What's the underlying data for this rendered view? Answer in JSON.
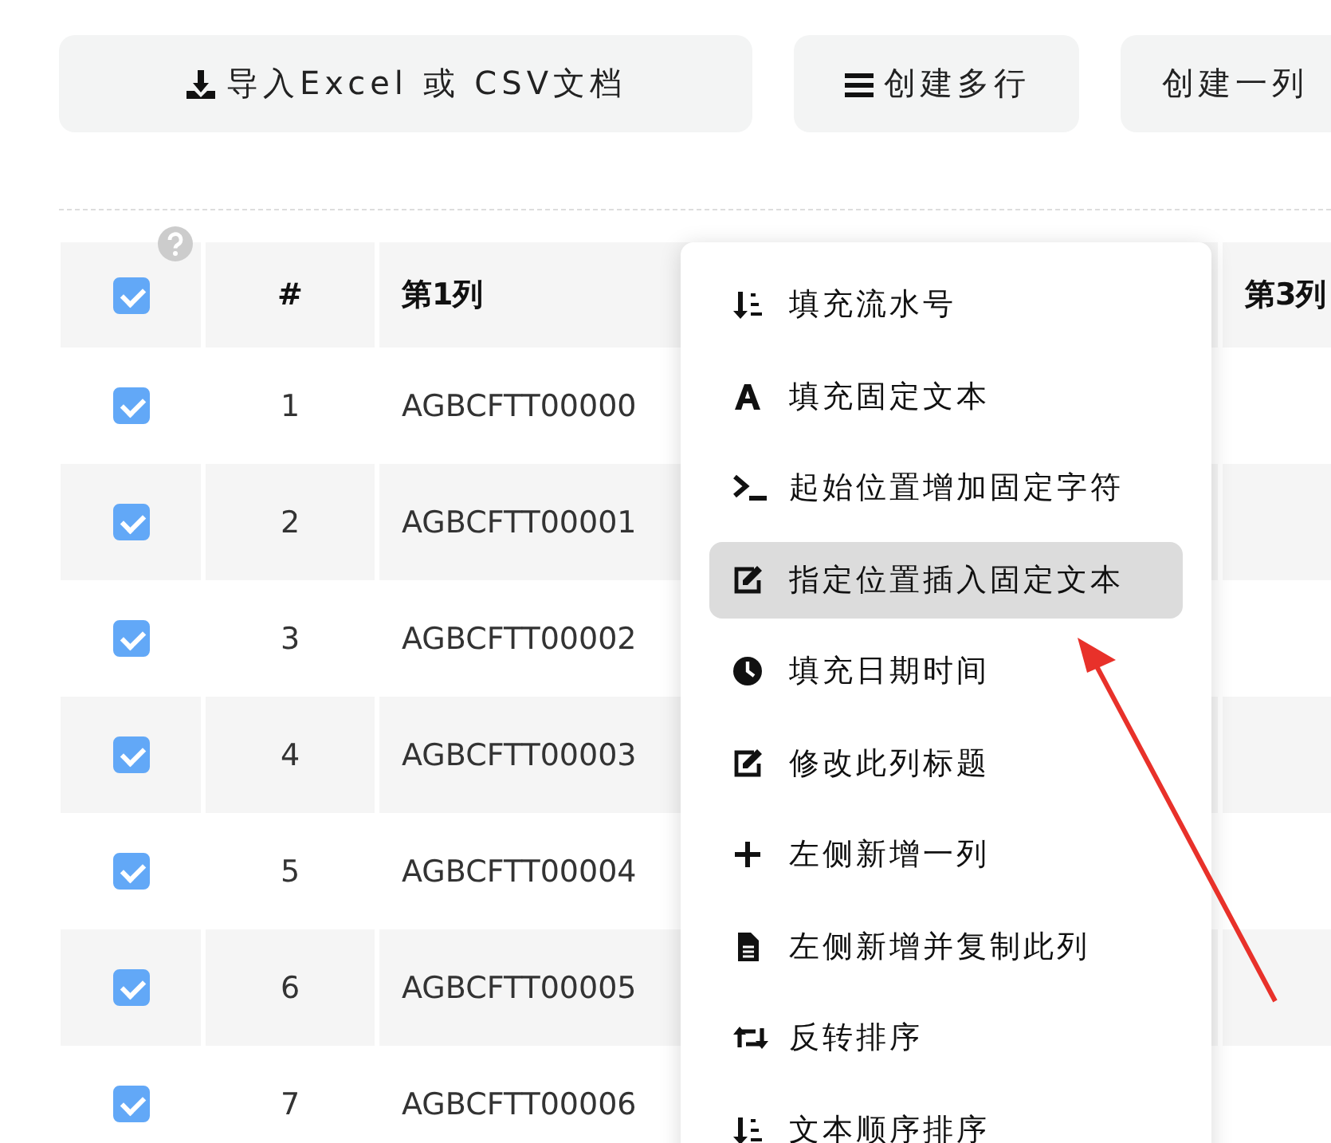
{
  "toolbar": [
    {
      "label": "导入Excel 或 CSV文档",
      "kind": "download"
    },
    {
      "label": "创建多行",
      "kind": "lines"
    },
    {
      "label": "创建一列",
      "kind": "plain"
    }
  ],
  "table": {
    "header_checked": true,
    "columns": [
      "#",
      "第1列",
      "第3列"
    ],
    "rows": [
      {
        "checked": true,
        "index": "1",
        "column_1": "AGBCFTT00000"
      },
      {
        "checked": true,
        "index": "2",
        "column_1": "AGBCFTT00001"
      },
      {
        "checked": true,
        "index": "3",
        "column_1": "AGBCFTT00002"
      },
      {
        "checked": true,
        "index": "4",
        "column_1": "AGBCFTT00003"
      },
      {
        "checked": true,
        "index": "5",
        "column_1": "AGBCFTT00004"
      },
      {
        "checked": true,
        "index": "6",
        "column_1": "AGBCFTT00005"
      },
      {
        "checked": true,
        "index": "7",
        "column_1": "AGBCFTT00006"
      }
    ]
  },
  "context_menu": [
    {
      "label": "填充流水号",
      "kind": "number",
      "selected": false
    },
    {
      "label": "填充固定文本",
      "kind": "text",
      "selected": false
    },
    {
      "label": "起始位置增加固定字符",
      "kind": "prefix",
      "selected": false
    },
    {
      "label": "指定位置插入固定文本",
      "kind": "insert",
      "selected": true
    },
    {
      "label": "填充日期时间",
      "kind": "datetime",
      "selected": false
    },
    {
      "label": "修改此列标题",
      "kind": "rename",
      "selected": false
    },
    {
      "label": "左侧新增一列",
      "kind": "add",
      "selected": false
    },
    {
      "label": "左侧新增并复制此列",
      "kind": "duplicate",
      "selected": false
    },
    {
      "label": "反转排序",
      "kind": "reverse",
      "selected": false
    },
    {
      "label": "文本顺序排序",
      "kind": "sort",
      "selected": false
    }
  ]
}
